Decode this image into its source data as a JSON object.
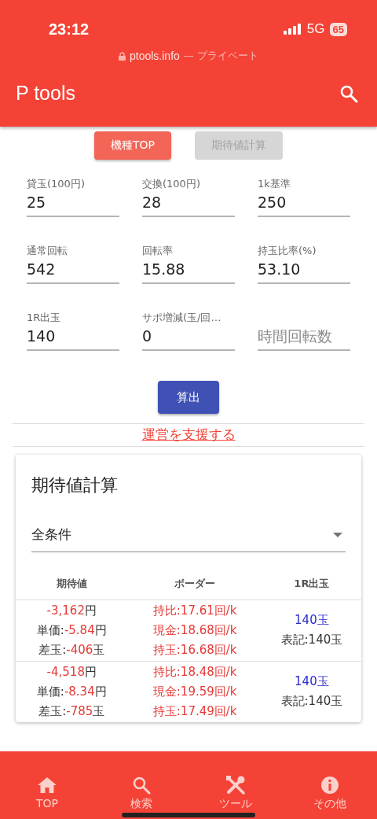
{
  "status_bar": {
    "time": "23:12",
    "network": "5G",
    "battery": "65"
  },
  "address_bar": {
    "domain": "ptools.info",
    "suffix": "— プライベート"
  },
  "app_bar": {
    "title": "P tools"
  },
  "nav_buttons": [
    {
      "label": "機種TOP",
      "selected": true
    },
    {
      "label": "期待値計算",
      "selected": false
    }
  ],
  "fields": [
    {
      "label": "貸玉(100円)",
      "value": "25"
    },
    {
      "label": "交換(100円)",
      "value": "28"
    },
    {
      "label": "1k基準",
      "value": "250"
    },
    {
      "label": "通常回転",
      "value": "542"
    },
    {
      "label": "回転率",
      "value": "15.88"
    },
    {
      "label": "持玉比率(%)",
      "value": "53.10"
    },
    {
      "label": "1R出玉",
      "value": "140"
    },
    {
      "label": "サポ増減(玉/回…",
      "value": "0"
    },
    {
      "placeholder": "時間回転数"
    }
  ],
  "calc_button": "算出",
  "support_link": "運営を支援する",
  "result_card": {
    "title": "期待値計算",
    "select_value": "全条件",
    "table": {
      "columns": [
        "期待値",
        "ボーダー",
        "1R出玉"
      ],
      "rows": [
        {
          "expected": [
            {
              "value": "-3,162",
              "unit": "円"
            },
            {
              "label": "単価:",
              "value": "-5.84",
              "unit": "円"
            },
            {
              "label": "差玉:",
              "value": "-406",
              "unit": "玉"
            }
          ],
          "border": [
            "持比:17.61回/k",
            "現金:18.68回/k",
            "持玉:16.68回/k"
          ],
          "payout": {
            "value": "140玉",
            "note": "表記:140玉"
          }
        },
        {
          "expected": [
            {
              "value": "-4,518",
              "unit": "円"
            },
            {
              "label": "単価:",
              "value": "-8.34",
              "unit": "円"
            },
            {
              "label": "差玉:",
              "value": "-785",
              "unit": "玉"
            }
          ],
          "border": [
            "持比:18.48回/k",
            "現金:19.59回/k",
            "持玉:17.49回/k"
          ],
          "payout": {
            "value": "140玉",
            "note": "表記:140玉"
          }
        }
      ]
    }
  },
  "bottom_nav": [
    {
      "kind": "home",
      "label": "TOP"
    },
    {
      "kind": "search",
      "label": "検索"
    },
    {
      "kind": "tools",
      "label": "ツール"
    },
    {
      "kind": "info",
      "label": "その他"
    }
  ]
}
